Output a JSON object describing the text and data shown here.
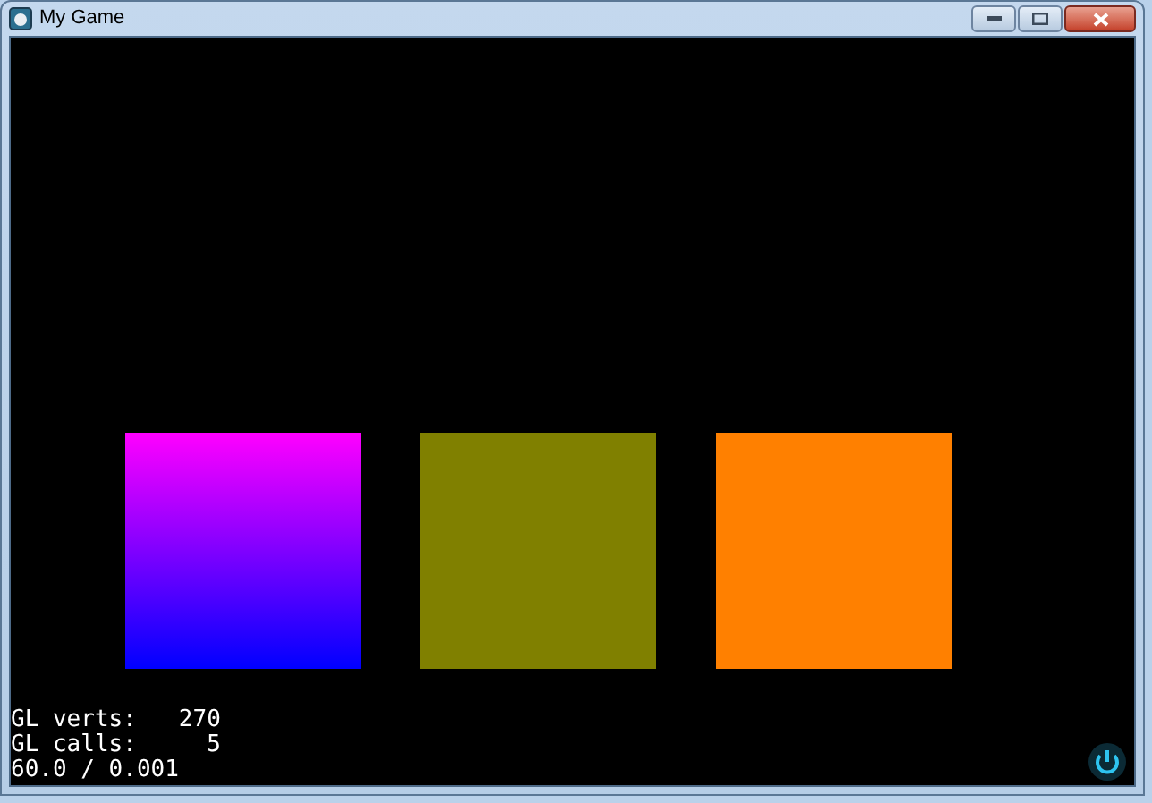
{
  "window": {
    "title": "My Game"
  },
  "squares": [
    {
      "kind": "gradient",
      "color": "#ff00ff"
    },
    {
      "kind": "solid",
      "color": "#808000"
    },
    {
      "kind": "solid",
      "color": "#ff8000"
    }
  ],
  "stats": [
    "GL verts:   270",
    "GL calls:     5",
    "60.0 / 0.001"
  ]
}
